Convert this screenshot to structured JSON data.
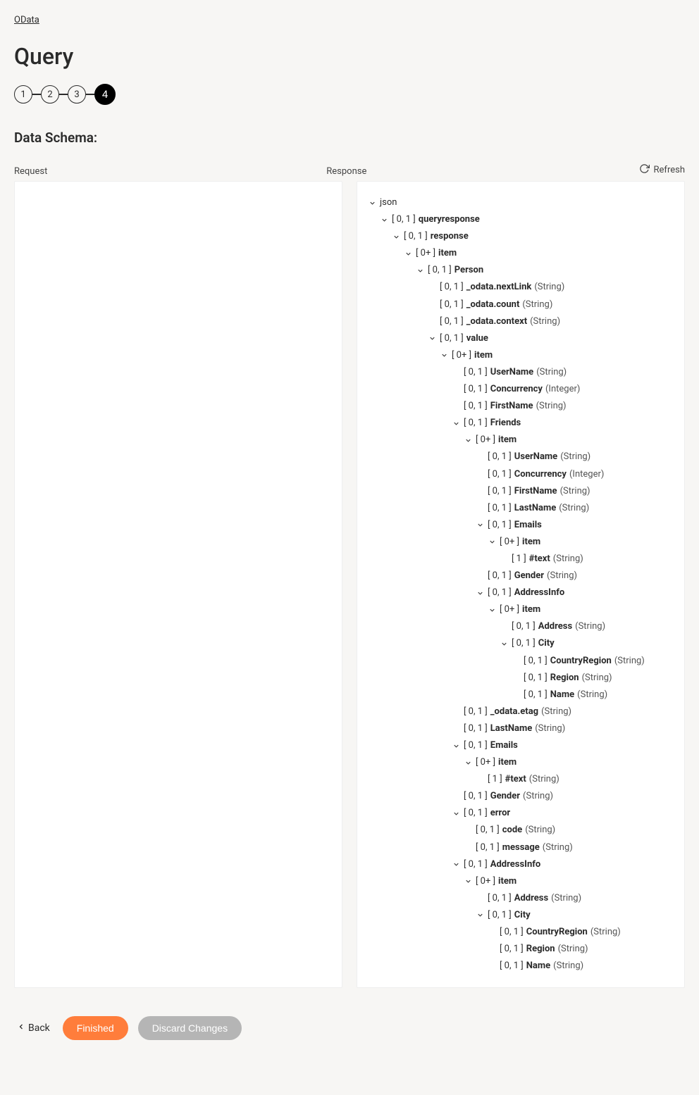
{
  "breadcrumb": "OData",
  "page_title": "Query",
  "stepper": {
    "steps": [
      "1",
      "2",
      "3",
      "4"
    ],
    "active_index": 3
  },
  "section_heading": "Data Schema:",
  "labels": {
    "request": "Request",
    "response": "Response",
    "refresh": "Refresh",
    "back": "Back",
    "finished": "Finished",
    "discard": "Discard Changes"
  },
  "tree": {
    "caret": true,
    "name": "json",
    "children": [
      {
        "caret": true,
        "card": "[ 0, 1 ]",
        "name": "queryresponse",
        "children": [
          {
            "caret": true,
            "card": "[ 0, 1 ]",
            "name": "response",
            "children": [
              {
                "caret": true,
                "card": "[ 0+ ]",
                "name": "item",
                "children": [
                  {
                    "caret": true,
                    "card": "[ 0, 1 ]",
                    "name": "Person",
                    "children": [
                      {
                        "caret": false,
                        "card": "[ 0, 1 ]",
                        "name": "_odata.nextLink",
                        "type": "(String)"
                      },
                      {
                        "caret": false,
                        "card": "[ 0, 1 ]",
                        "name": "_odata.count",
                        "type": "(String)"
                      },
                      {
                        "caret": false,
                        "card": "[ 0, 1 ]",
                        "name": "_odata.context",
                        "type": "(String)"
                      },
                      {
                        "caret": true,
                        "card": "[ 0, 1 ]",
                        "name": "value",
                        "children": [
                          {
                            "caret": true,
                            "card": "[ 0+ ]",
                            "name": "item",
                            "children": [
                              {
                                "caret": false,
                                "card": "[ 0, 1 ]",
                                "name": "UserName",
                                "type": "(String)"
                              },
                              {
                                "caret": false,
                                "card": "[ 0, 1 ]",
                                "name": "Concurrency",
                                "type": "(Integer)"
                              },
                              {
                                "caret": false,
                                "card": "[ 0, 1 ]",
                                "name": "FirstName",
                                "type": "(String)"
                              },
                              {
                                "caret": true,
                                "card": "[ 0, 1 ]",
                                "name": "Friends",
                                "children": [
                                  {
                                    "caret": true,
                                    "card": "[ 0+ ]",
                                    "name": "item",
                                    "children": [
                                      {
                                        "caret": false,
                                        "card": "[ 0, 1 ]",
                                        "name": "UserName",
                                        "type": "(String)"
                                      },
                                      {
                                        "caret": false,
                                        "card": "[ 0, 1 ]",
                                        "name": "Concurrency",
                                        "type": "(Integer)"
                                      },
                                      {
                                        "caret": false,
                                        "card": "[ 0, 1 ]",
                                        "name": "FirstName",
                                        "type": "(String)"
                                      },
                                      {
                                        "caret": false,
                                        "card": "[ 0, 1 ]",
                                        "name": "LastName",
                                        "type": "(String)"
                                      },
                                      {
                                        "caret": true,
                                        "card": "[ 0, 1 ]",
                                        "name": "Emails",
                                        "children": [
                                          {
                                            "caret": true,
                                            "card": "[ 0+ ]",
                                            "name": "item",
                                            "children": [
                                              {
                                                "caret": false,
                                                "card": "[ 1 ]",
                                                "name": "#text",
                                                "type": "(String)"
                                              }
                                            ]
                                          }
                                        ]
                                      },
                                      {
                                        "caret": false,
                                        "card": "[ 0, 1 ]",
                                        "name": "Gender",
                                        "type": "(String)"
                                      },
                                      {
                                        "caret": true,
                                        "card": "[ 0, 1 ]",
                                        "name": "AddressInfo",
                                        "children": [
                                          {
                                            "caret": true,
                                            "card": "[ 0+ ]",
                                            "name": "item",
                                            "children": [
                                              {
                                                "caret": false,
                                                "card": "[ 0, 1 ]",
                                                "name": "Address",
                                                "type": "(String)"
                                              },
                                              {
                                                "caret": true,
                                                "card": "[ 0, 1 ]",
                                                "name": "City",
                                                "children": [
                                                  {
                                                    "caret": false,
                                                    "card": "[ 0, 1 ]",
                                                    "name": "CountryRegion",
                                                    "type": "(String)"
                                                  },
                                                  {
                                                    "caret": false,
                                                    "card": "[ 0, 1 ]",
                                                    "name": "Region",
                                                    "type": "(String)"
                                                  },
                                                  {
                                                    "caret": false,
                                                    "card": "[ 0, 1 ]",
                                                    "name": "Name",
                                                    "type": "(String)"
                                                  }
                                                ]
                                              }
                                            ]
                                          }
                                        ]
                                      }
                                    ]
                                  }
                                ]
                              },
                              {
                                "caret": false,
                                "card": "[ 0, 1 ]",
                                "name": "_odata.etag",
                                "type": "(String)"
                              },
                              {
                                "caret": false,
                                "card": "[ 0, 1 ]",
                                "name": "LastName",
                                "type": "(String)"
                              },
                              {
                                "caret": true,
                                "card": "[ 0, 1 ]",
                                "name": "Emails",
                                "children": [
                                  {
                                    "caret": true,
                                    "card": "[ 0+ ]",
                                    "name": "item",
                                    "children": [
                                      {
                                        "caret": false,
                                        "card": "[ 1 ]",
                                        "name": "#text",
                                        "type": "(String)"
                                      }
                                    ]
                                  }
                                ]
                              },
                              {
                                "caret": false,
                                "card": "[ 0, 1 ]",
                                "name": "Gender",
                                "type": "(String)"
                              },
                              {
                                "caret": true,
                                "card": "[ 0, 1 ]",
                                "name": "error",
                                "children": [
                                  {
                                    "caret": false,
                                    "card": "[ 0, 1 ]",
                                    "name": "code",
                                    "type": "(String)"
                                  },
                                  {
                                    "caret": false,
                                    "card": "[ 0, 1 ]",
                                    "name": "message",
                                    "type": "(String)"
                                  }
                                ]
                              },
                              {
                                "caret": true,
                                "card": "[ 0, 1 ]",
                                "name": "AddressInfo",
                                "children": [
                                  {
                                    "caret": true,
                                    "card": "[ 0+ ]",
                                    "name": "item",
                                    "children": [
                                      {
                                        "caret": false,
                                        "card": "[ 0, 1 ]",
                                        "name": "Address",
                                        "type": "(String)"
                                      },
                                      {
                                        "caret": true,
                                        "card": "[ 0, 1 ]",
                                        "name": "City",
                                        "children": [
                                          {
                                            "caret": false,
                                            "card": "[ 0, 1 ]",
                                            "name": "CountryRegion",
                                            "type": "(String)"
                                          },
                                          {
                                            "caret": false,
                                            "card": "[ 0, 1 ]",
                                            "name": "Region",
                                            "type": "(String)"
                                          },
                                          {
                                            "caret": false,
                                            "card": "[ 0, 1 ]",
                                            "name": "Name",
                                            "type": "(String)"
                                          }
                                        ]
                                      }
                                    ]
                                  }
                                ]
                              }
                            ]
                          }
                        ]
                      }
                    ]
                  }
                ]
              }
            ]
          }
        ]
      }
    ]
  }
}
